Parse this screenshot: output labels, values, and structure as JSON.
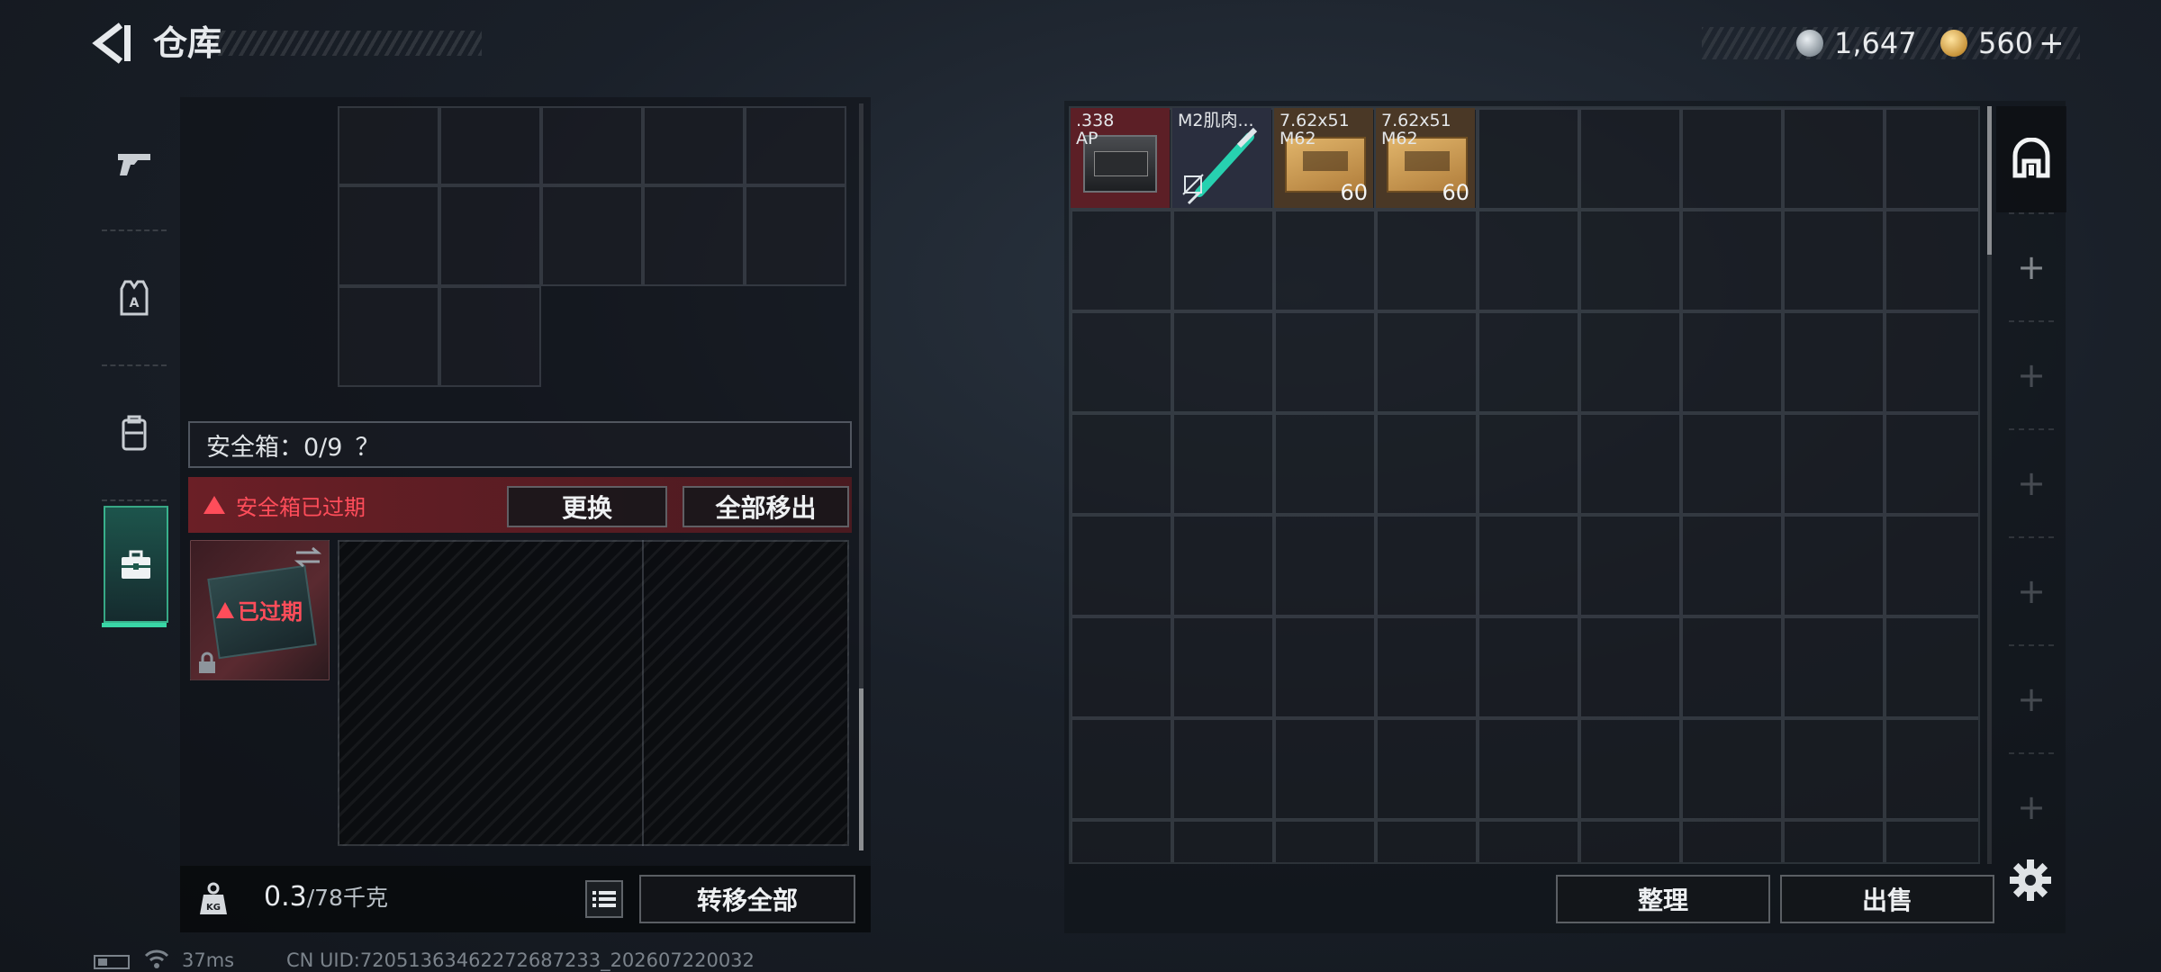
{
  "header": {
    "title": "仓库",
    "currency_silver": "1,647",
    "currency_gold": "560",
    "currency_plus": "+"
  },
  "left_rail": {
    "items": [
      {
        "icon": "pistol-icon"
      },
      {
        "icon": "armor-vest-icon"
      },
      {
        "icon": "backpack-icon"
      },
      {
        "icon": "briefcase-icon",
        "active": true
      }
    ]
  },
  "safe_box": {
    "header_label": "安全箱：0/9",
    "help": "？",
    "warning": "安全箱已过期",
    "swap_label": "更换",
    "move_all_label": "全部移出",
    "thumb_status": "已过期"
  },
  "footer_left": {
    "weight_value": "0.3",
    "weight_max": "/78千克",
    "transfer_all_label": "转移全部"
  },
  "stash": {
    "items": [
      {
        "label": ".338\nAP",
        "count": ""
      },
      {
        "label": "M2肌肉...",
        "count": ""
      },
      {
        "label": "7.62x51\nM62",
        "count": "60"
      },
      {
        "label": "7.62x51\nM62",
        "count": "60"
      }
    ],
    "sort_label": "整理",
    "sell_label": "出售"
  },
  "status_bar": {
    "ping": "37ms",
    "uid": "CN UID:72051363462272687233_202607220032"
  },
  "colors": {
    "accent_green": "#39d6a6",
    "warning_red": "#ff4d5a",
    "expired_bar": "#6b1f26"
  }
}
